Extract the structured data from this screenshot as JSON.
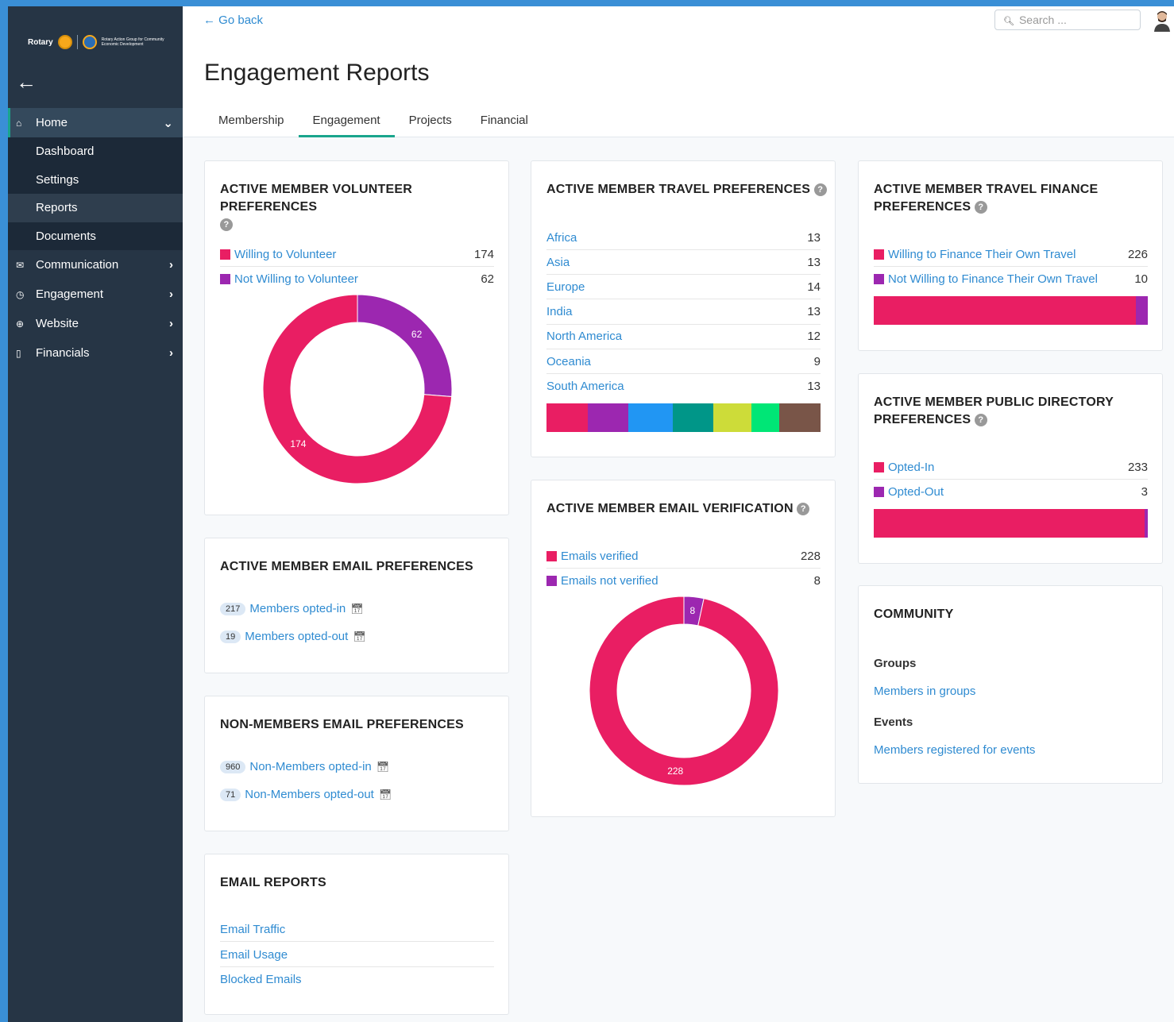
{
  "sidebar": {
    "logo_text": "Rotary",
    "logo_sub": "Rotary Action Group for Community Economic Development",
    "items": [
      {
        "label": "Home"
      },
      {
        "label": "Communication"
      },
      {
        "label": "Engagement"
      },
      {
        "label": "Website"
      },
      {
        "label": "Financials"
      }
    ],
    "home_sub": [
      "Dashboard",
      "Settings",
      "Reports",
      "Documents"
    ]
  },
  "topbar": {
    "go_back": "Go back",
    "search_placeholder": "Search ..."
  },
  "page_title": "Engagement Reports",
  "tabs": [
    "Membership",
    "Engagement",
    "Projects",
    "Financial"
  ],
  "colors": {
    "pink": "#e91e63",
    "purple": "#9c27b0",
    "accent": "#1aa58d",
    "link": "#2f8bd1"
  },
  "volunteer": {
    "title": "ACTIVE MEMBER VOLUNTEER PREFERENCES",
    "rows": [
      {
        "label": "Willing to Volunteer",
        "value": "174"
      },
      {
        "label": "Not Willing to Volunteer",
        "value": "62"
      }
    ]
  },
  "email_prefs": {
    "title": "ACTIVE MEMBER EMAIL PREFERENCES",
    "rows": [
      {
        "count": "217",
        "label": "Members opted-in"
      },
      {
        "count": "19",
        "label": "Members opted-out"
      }
    ]
  },
  "nonmember_prefs": {
    "title": "NON-MEMBERS EMAIL PREFERENCES",
    "rows": [
      {
        "count": "960",
        "label": "Non-Members opted-in"
      },
      {
        "count": "71",
        "label": "Non-Members opted-out"
      }
    ]
  },
  "email_reports": {
    "title": "EMAIL REPORTS",
    "links": [
      "Email Traffic",
      "Email Usage",
      "Blocked Emails"
    ]
  },
  "travel": {
    "title": "ACTIVE MEMBER TRAVEL PREFERENCES",
    "rows": [
      {
        "label": "Africa",
        "value": "13"
      },
      {
        "label": "Asia",
        "value": "13"
      },
      {
        "label": "Europe",
        "value": "14"
      },
      {
        "label": "India",
        "value": "13"
      },
      {
        "label": "North America",
        "value": "12"
      },
      {
        "label": "Oceania",
        "value": "9"
      },
      {
        "label": "South America",
        "value": "13"
      }
    ],
    "bar_colors": [
      "#e91e63",
      "#9c27b0",
      "#2196f3",
      "#009688",
      "#cddc39",
      "#00e676",
      "#795548"
    ]
  },
  "email_verif": {
    "title": "ACTIVE MEMBER EMAIL VERIFICATION",
    "rows": [
      {
        "label": "Emails verified",
        "value": "228"
      },
      {
        "label": "Emails not verified",
        "value": "8"
      }
    ]
  },
  "travel_finance": {
    "title_line1": "ACTIVE MEMBER TRAVEL FINANCE",
    "title_line2": "PREFERENCES",
    "rows": [
      {
        "label": "Willing to Finance Their Own Travel",
        "value": "226"
      },
      {
        "label": "Not Willing to Finance Their Own Travel",
        "value": "10"
      }
    ]
  },
  "public_dir": {
    "title_line1": "ACTIVE MEMBER PUBLIC DIRECTORY",
    "title_line2": "PREFERENCES",
    "rows": [
      {
        "label": "Opted-In",
        "value": "233"
      },
      {
        "label": "Opted-Out",
        "value": "3"
      }
    ]
  },
  "community": {
    "title": "COMMUNITY",
    "groups_heading": "Groups",
    "groups_link": "Members in groups",
    "events_heading": "Events",
    "events_link": "Members registered for events"
  },
  "chart_data": [
    {
      "type": "pie",
      "categories": [
        "Willing to Volunteer",
        "Not Willing to Volunteer"
      ],
      "values": [
        174,
        62
      ]
    },
    {
      "type": "bar",
      "categories": [
        "Africa",
        "Asia",
        "Europe",
        "India",
        "North America",
        "Oceania",
        "South America"
      ],
      "values": [
        13,
        13,
        14,
        13,
        12,
        9,
        13
      ]
    },
    {
      "type": "pie",
      "categories": [
        "Emails verified",
        "Emails not verified"
      ],
      "values": [
        228,
        8
      ]
    },
    {
      "type": "bar",
      "categories": [
        "Willing to Finance Their Own Travel",
        "Not Willing to Finance Their Own Travel"
      ],
      "values": [
        226,
        10
      ]
    },
    {
      "type": "bar",
      "categories": [
        "Opted-In",
        "Opted-Out"
      ],
      "values": [
        233,
        3
      ]
    }
  ]
}
